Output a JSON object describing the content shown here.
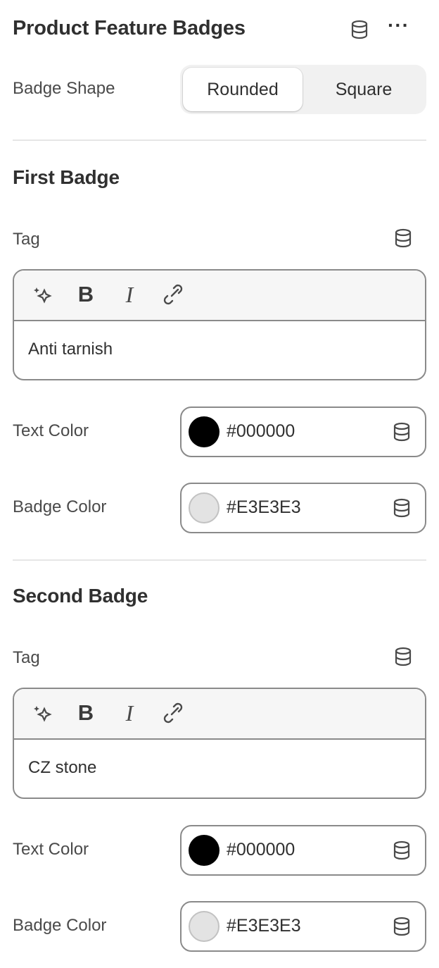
{
  "panel": {
    "title": "Product Feature Badges",
    "header_icons": [
      "database-icon",
      "more-horizontal-icon"
    ]
  },
  "badge_shape": {
    "label": "Badge Shape",
    "options": [
      "Rounded",
      "Square"
    ],
    "selected": "Rounded"
  },
  "first_badge": {
    "title": "First Badge",
    "tag_label": "Tag",
    "toolbar": {
      "bold": "B",
      "italic": "I",
      "icons": [
        "magic-icon",
        "bold-icon",
        "italic-icon",
        "link-icon"
      ]
    },
    "tag_value": "Anti tarnish",
    "text_color": {
      "label": "Text Color",
      "value": "#000000",
      "swatch": "#000000"
    },
    "badge_color": {
      "label": "Badge Color",
      "value": "#E3E3E3",
      "swatch": "#E3E3E3"
    }
  },
  "second_badge": {
    "title": "Second Badge",
    "tag_label": "Tag",
    "toolbar": {
      "bold": "B",
      "italic": "I",
      "icons": [
        "magic-icon",
        "bold-icon",
        "italic-icon",
        "link-icon"
      ]
    },
    "tag_value": "CZ stone",
    "text_color": {
      "label": "Text Color",
      "value": "#000000",
      "swatch": "#000000"
    },
    "badge_color": {
      "label": "Badge Color",
      "value": "#E3E3E3",
      "swatch": "#E3E3E3"
    }
  },
  "colors": {
    "text": "#303030",
    "border": "#8a8a8a",
    "segment_bg": "#f1f1f1",
    "divider": "#e6e6e6"
  }
}
